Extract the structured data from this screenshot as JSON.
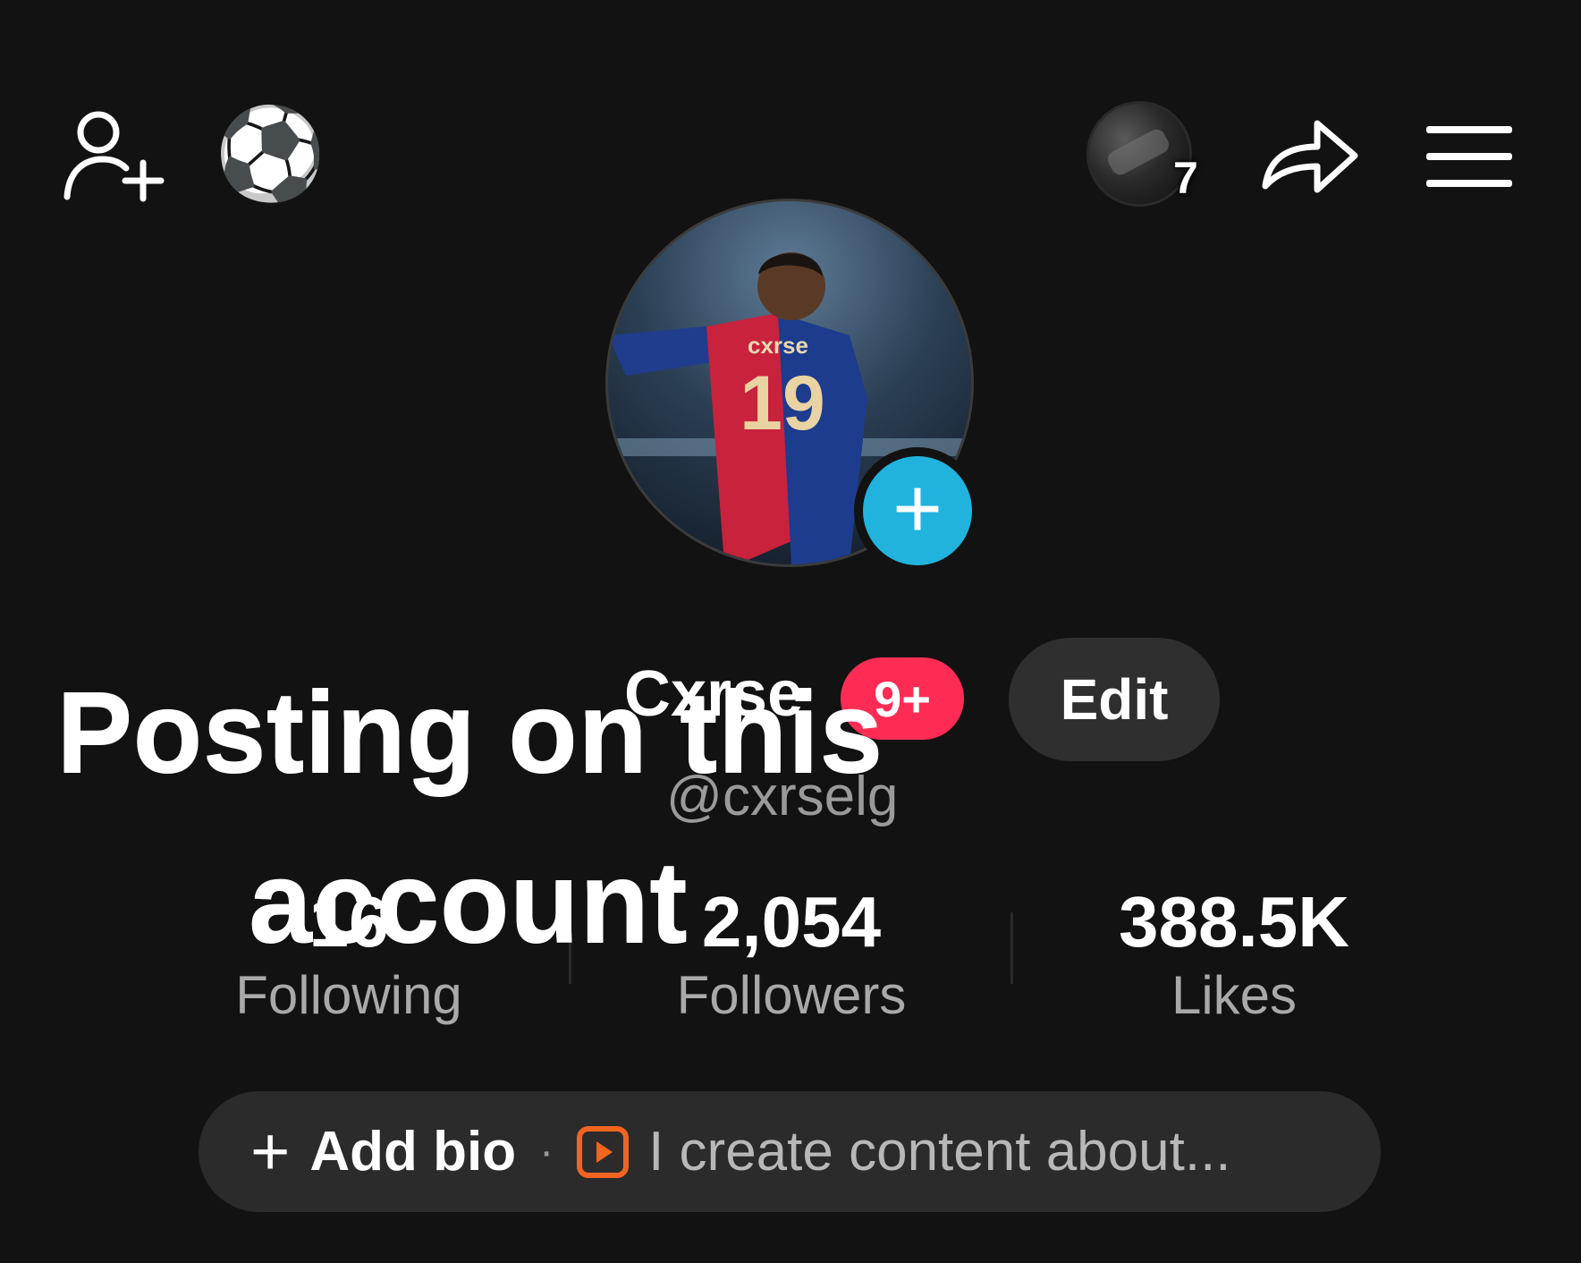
{
  "header": {
    "add_friend_icon": "add-person-icon",
    "emoji": "⚽",
    "story_count": "7",
    "share_icon": "share-arrow-icon",
    "menu_icon": "hamburger-menu-icon"
  },
  "profile": {
    "jersey_name": "cxrse",
    "jersey_number": "19",
    "display_name": "Cxrse",
    "notification_badge": "9+",
    "edit_label": "Edit",
    "username": "@cxrselg"
  },
  "stats": {
    "following_value": "16",
    "following_label": "Following",
    "followers_value": "2,054",
    "followers_label": "Followers",
    "likes_value": "388.5K",
    "likes_label": "Likes"
  },
  "bio": {
    "plus": "+",
    "add_label": "Add bio",
    "separator": "·",
    "prompt": "I create content about..."
  },
  "overlay": {
    "line1": "Posting on this",
    "line2": "account"
  },
  "colors": {
    "background": "#121212",
    "accent_blue": "#21b3de",
    "badge_red": "#fe2c55",
    "bio_icon_orange": "#f2641f"
  }
}
